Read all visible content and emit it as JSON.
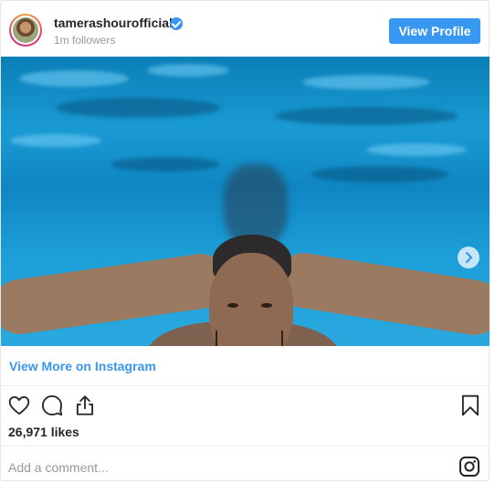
{
  "header": {
    "username": "tamerashourofficial",
    "followers": "1m followers",
    "view_profile_label": "View Profile",
    "verified_icon": "verified-badge-icon"
  },
  "post": {
    "image_alt": "Man swimming underwater in a pool",
    "next_icon": "chevron-right-icon"
  },
  "links": {
    "view_more_label": "View More on Instagram"
  },
  "actions": {
    "like_icon": "heart-icon",
    "comment_icon": "comment-icon",
    "share_icon": "share-icon",
    "save_icon": "bookmark-icon",
    "likes_count": "26,971 likes"
  },
  "comment": {
    "placeholder": "Add a comment..."
  },
  "footer": {
    "logo_icon": "instagram-icon"
  },
  "colors": {
    "accent": "#3897f0",
    "text": "#262626",
    "muted": "#999999"
  }
}
